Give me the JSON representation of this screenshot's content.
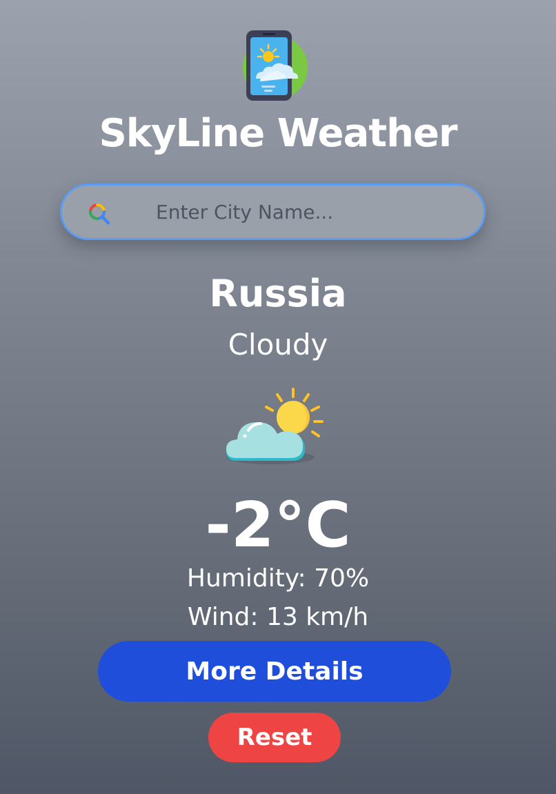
{
  "app": {
    "title": "SkyLine Weather",
    "logo_icon": "phone-weather-logo-icon"
  },
  "search": {
    "placeholder": "Enter City Name...",
    "value": "",
    "icon": "search-icon"
  },
  "weather": {
    "city": "Russia",
    "condition": "Cloudy",
    "condition_icon": "partly-cloudy-icon",
    "temperature": "-2°C",
    "humidity": "Humidity: 70%",
    "wind": "Wind: 13 km/h"
  },
  "buttons": {
    "more_details": "More Details",
    "reset": "Reset"
  },
  "colors": {
    "primary_button": "#1f4edb",
    "reset_button": "#ee4444",
    "search_border": "#5b9cf2",
    "text": "#ffffff"
  }
}
